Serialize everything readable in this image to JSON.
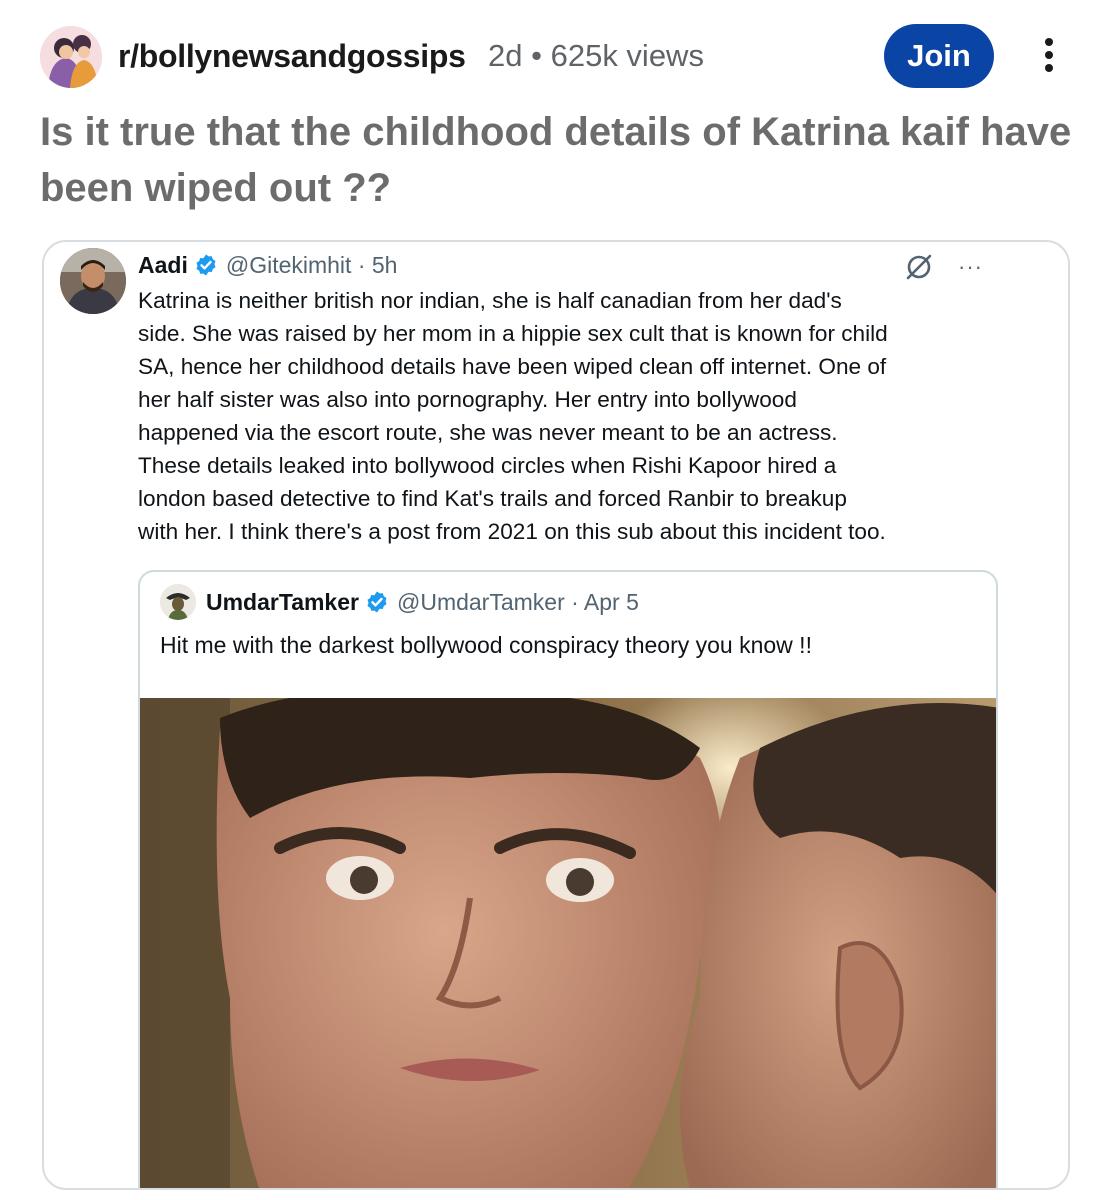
{
  "post": {
    "subreddit": "r/bollynewsandgossips",
    "age": "2d",
    "separator": "•",
    "views": "625k views",
    "join_label": "Join",
    "title": "Is it true that the childhood details of Katrina kaif have been wiped out ??",
    "icons": [
      "subreddit-avatar",
      "more-options-icon"
    ],
    "accent_color": "#0a45a6"
  },
  "tweet": {
    "name": "Aadi",
    "handle_time": "@Gitekimhit · 5h",
    "dots": "···",
    "lines": [
      "Katrina is neither british nor indian, she is half canadian from her dad's",
      "side. She was raised by her mom in a hippie sex cult that is known for child",
      "SA, hence her childhood details have been wiped clean off internet. One of",
      "her half sister was also into pornography. Her entry into bollywood",
      "happened via the escort route, she was never meant to be an actress.",
      "These details leaked into bollywood circles when Rishi Kapoor hired a",
      "london based detective to find Kat's trails and forced Ranbir to breakup",
      "with her. I think there's a post from 2021 on this sub about this incident too."
    ],
    "icons": [
      "verified-badge-icon",
      "grok-icon",
      "more-icon"
    ],
    "verified_color": "#1d9bf0"
  },
  "quote": {
    "name": "UmdarTamker",
    "handle_time": "@UmdarTamker · Apr 5",
    "text": "Hit me with the darkest bollywood conspiracy theory you know !!",
    "icons": [
      "verified-badge-icon"
    ]
  }
}
